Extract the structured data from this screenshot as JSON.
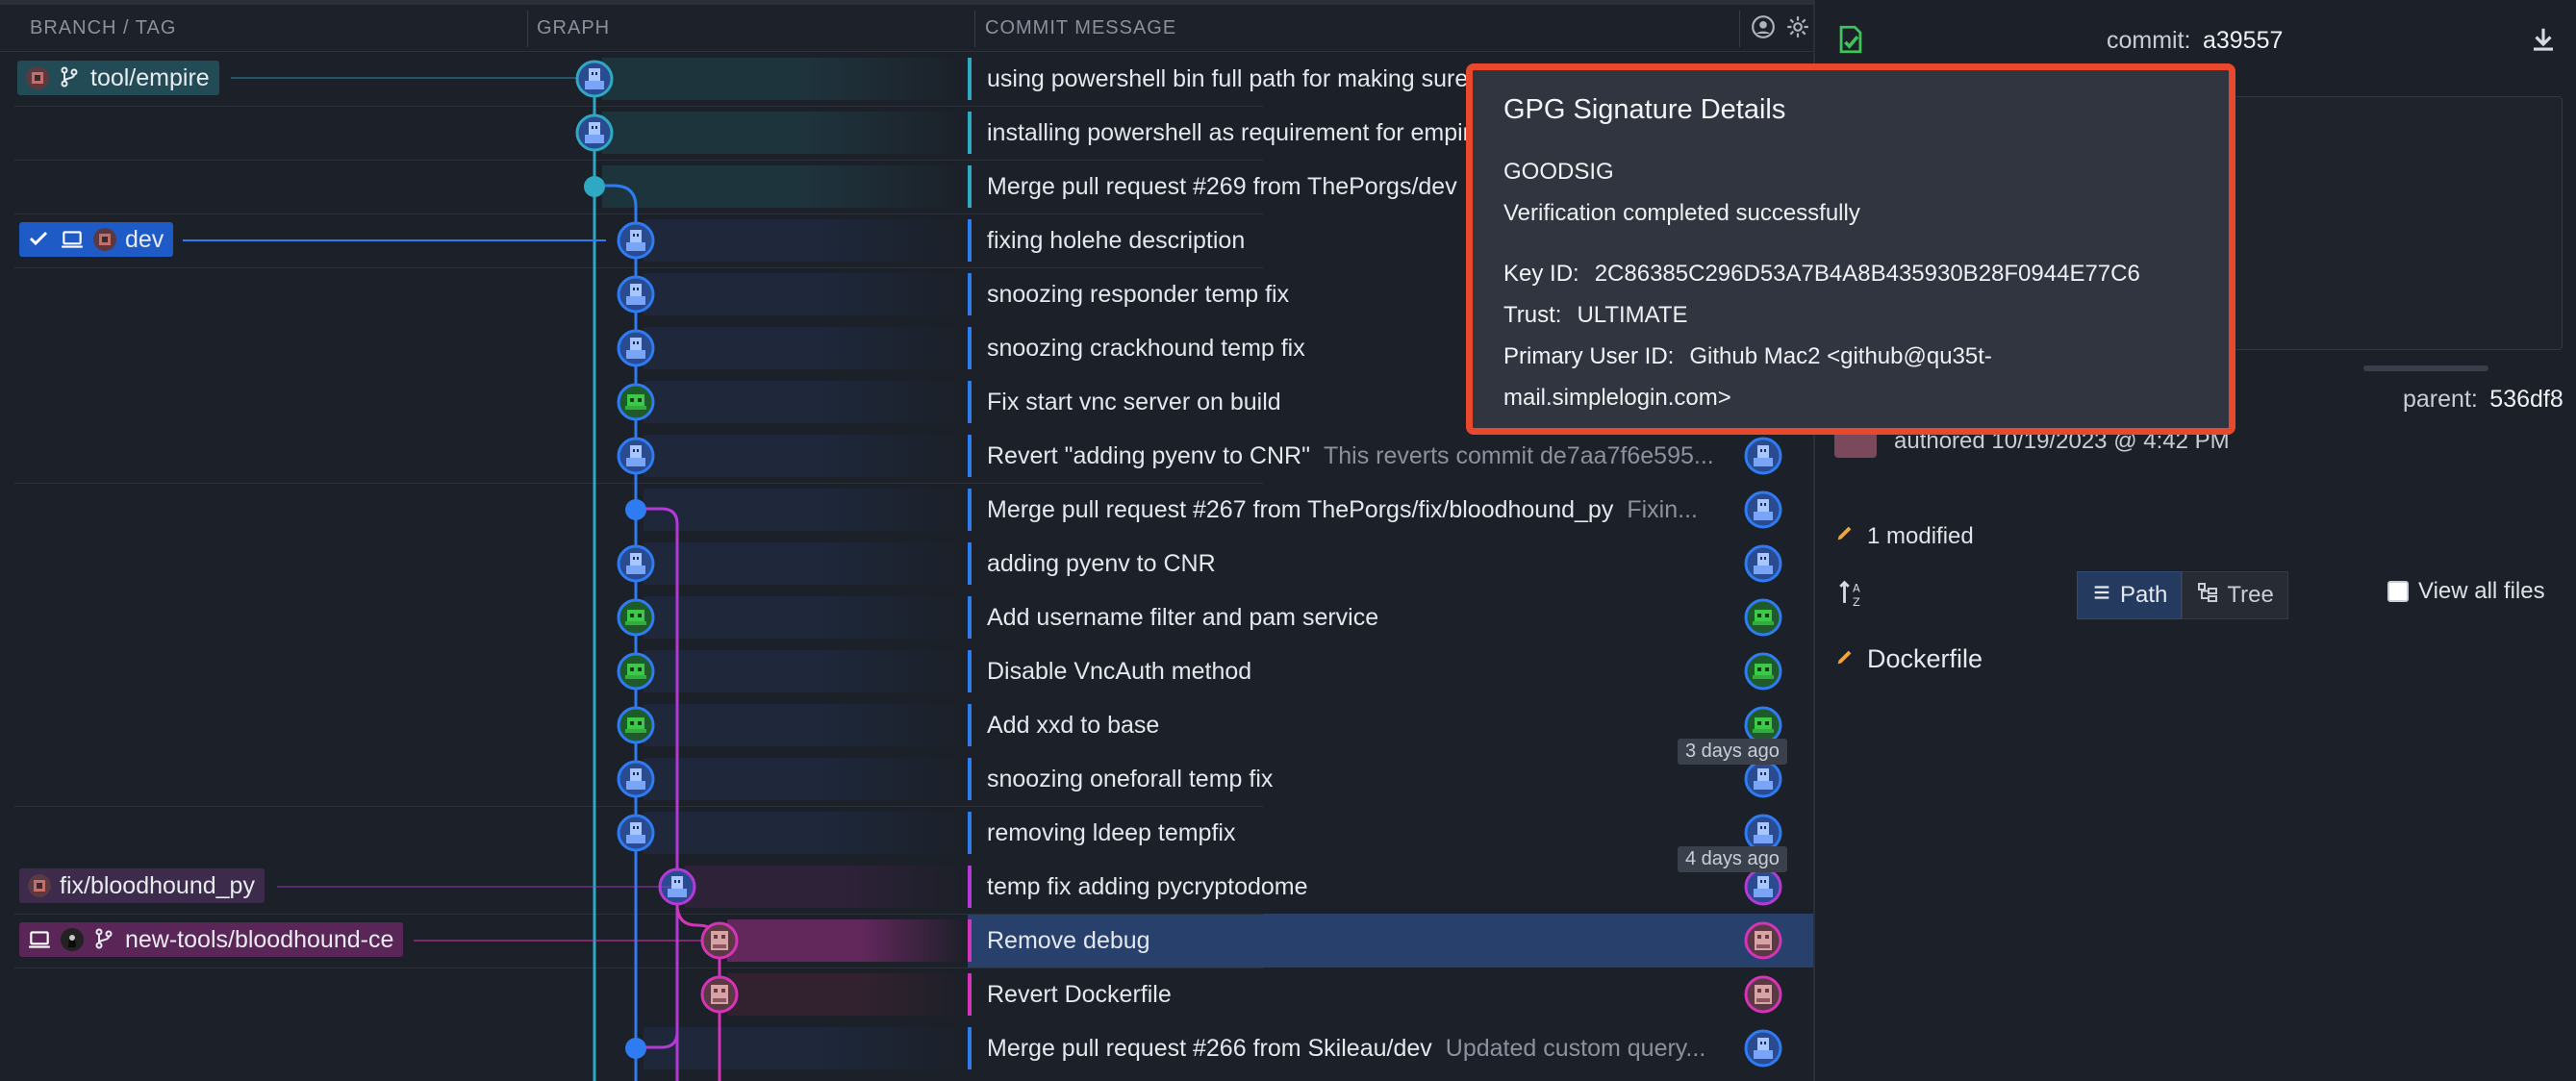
{
  "columns": {
    "branch": "BRANCH / TAG",
    "graph": "GRAPH",
    "message": "COMMIT MESSAGE"
  },
  "colors": {
    "blue": "#2f7cf2",
    "teal": "#2ea8c3",
    "purple": "#b43ad8",
    "pink": "#d533b8",
    "background": "#1c2028",
    "tooltip_border": "#e8492d",
    "selected_row": "#27406c"
  },
  "branches": [
    {
      "label": "tool/empire",
      "icons": [
        "avatar-icon",
        "branch-icon"
      ]
    },
    {
      "label": "dev",
      "icons": [
        "check-icon",
        "laptop-icon",
        "avatar-icon"
      ]
    },
    {
      "label": "fix/bloodhound_py",
      "icons": [
        "avatar-icon"
      ]
    },
    {
      "label": "new-tools/bloodhound-ce",
      "icons": [
        "laptop-icon",
        "avatar-icon",
        "branch-icon"
      ]
    }
  ],
  "commits": [
    {
      "message": "using powershell bin full path for making sure",
      "sub": ""
    },
    {
      "message": "installing powershell as requirement for empire",
      "sub": ""
    },
    {
      "message": "Merge pull request #269 from ThePorgs/dev",
      "sub": ""
    },
    {
      "message": "fixing holehe description",
      "sub": ""
    },
    {
      "message": "snoozing responder temp fix",
      "sub": ""
    },
    {
      "message": "snoozing crackhound temp fix",
      "sub": ""
    },
    {
      "message": "Fix start vnc server on build",
      "sub": ""
    },
    {
      "message": "Revert \"adding pyenv to CNR\"",
      "sub": "This reverts commit de7aa7f6e595..."
    },
    {
      "message": "Merge pull request #267 from ThePorgs/fix/bloodhound_py",
      "sub": "Fixin..."
    },
    {
      "message": "adding pyenv to CNR",
      "sub": ""
    },
    {
      "message": "Add username filter and pam service",
      "sub": ""
    },
    {
      "message": "Disable VncAuth method",
      "sub": ""
    },
    {
      "message": "Add xxd to base",
      "sub": ""
    },
    {
      "message": "snoozing oneforall temp fix",
      "sub": ""
    },
    {
      "message": "removing ldeep tempfix",
      "sub": ""
    },
    {
      "message": "temp fix adding pycryptodome",
      "sub": ""
    },
    {
      "message": "Remove debug",
      "sub": ""
    },
    {
      "message": "Revert Dockerfile",
      "sub": ""
    },
    {
      "message": "Merge pull request #266 from Skileau/dev",
      "sub": "Updated custom query..."
    }
  ],
  "time_markers": [
    "3 days ago",
    "4 days ago"
  ],
  "details": {
    "commit_label": "commit:",
    "commit_sha": "a39557",
    "parent_label": "parent:",
    "parent_sha": "536df8",
    "authored": "authored 10/19/2023 @ 4:42 PM",
    "modified": "1 modified",
    "path_tab": "Path",
    "tree_tab": "Tree",
    "view_all": "View all files",
    "file": "Dockerfile"
  },
  "gpg": {
    "title": "GPG Signature Details",
    "status": "GOODSIG",
    "result": "Verification completed successfully",
    "key_label": "Key ID:",
    "key_id": "2C86385C296D53A7B4A8B435930B28F0944E77C6",
    "trust_label": "Trust:",
    "trust": "ULTIMATE",
    "uid_label": "Primary User ID:",
    "uid_line1": "Github Mac2 <github@qu35t-",
    "uid_line2": "mail.simplelogin.com>"
  }
}
